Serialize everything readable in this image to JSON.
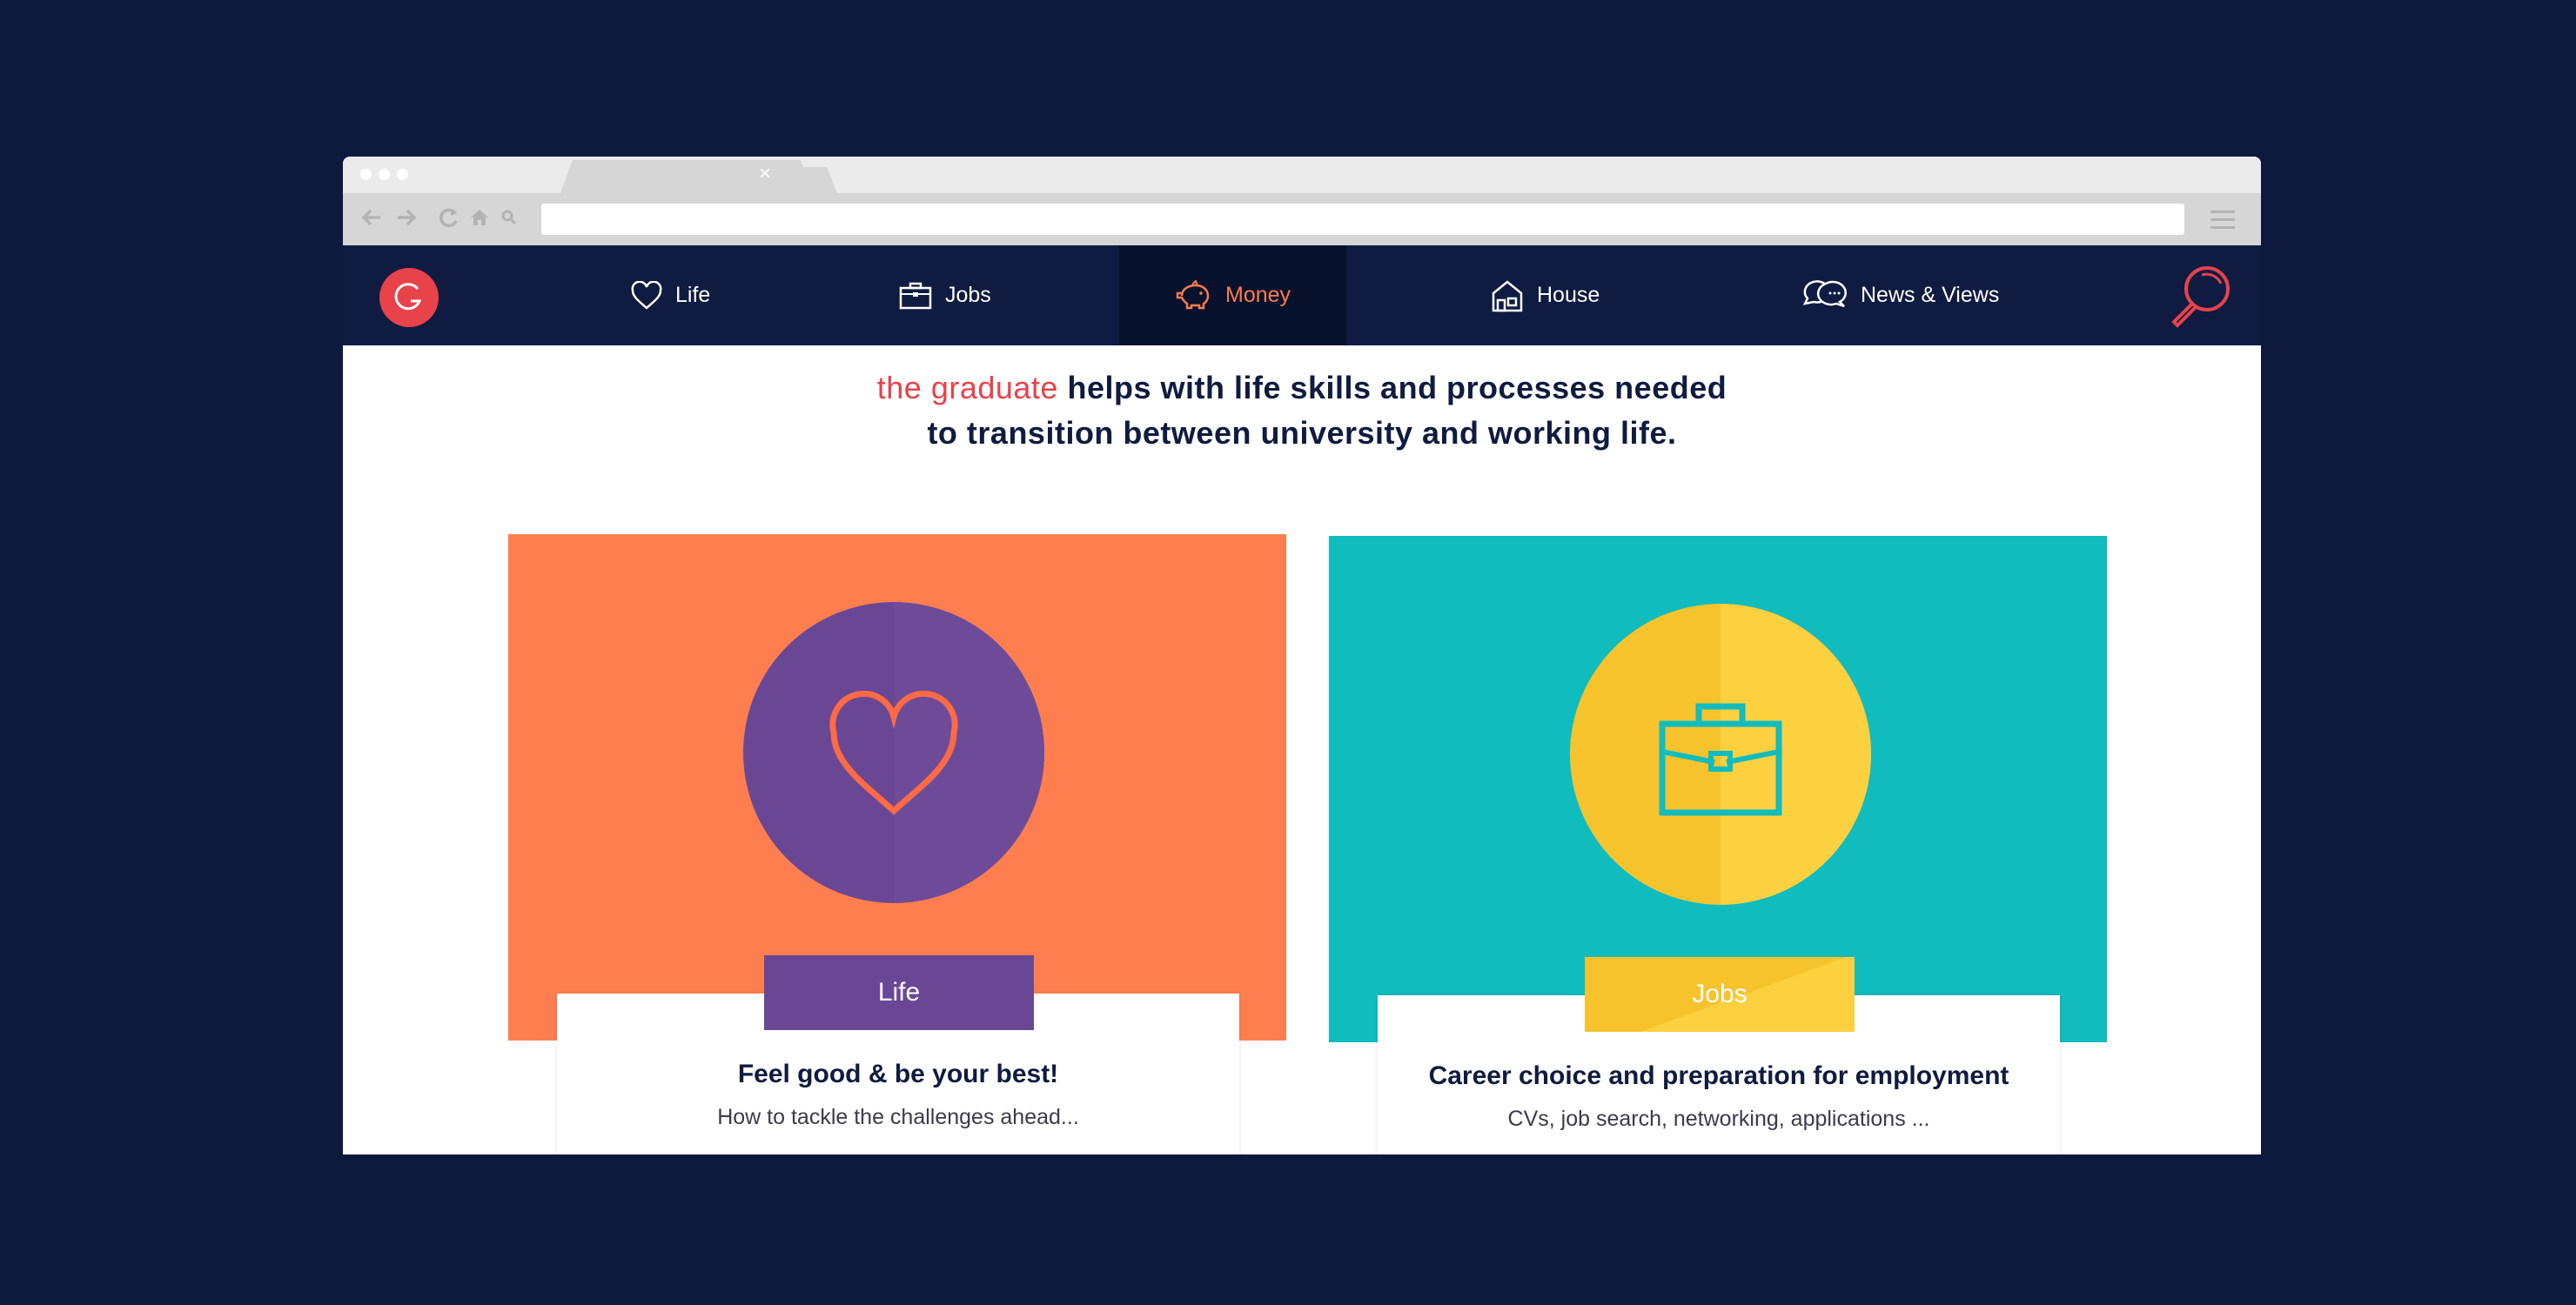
{
  "browser": {
    "tab_close_glyph": "×",
    "icons": [
      "back-arrow-icon",
      "forward-arrow-icon",
      "reload-icon",
      "home-icon",
      "search-icon",
      "hamburger-menu-icon"
    ]
  },
  "nav": {
    "items": [
      {
        "label": "Life",
        "icon": "heart-icon"
      },
      {
        "label": "Jobs",
        "icon": "briefcase-icon"
      },
      {
        "label": "Money",
        "icon": "piggy-bank-icon",
        "active": true
      },
      {
        "label": "House",
        "icon": "house-icon"
      },
      {
        "label": "News & Views",
        "icon": "chat-bubbles-icon"
      }
    ]
  },
  "intro": {
    "brand": "the graduate",
    "line1_rest": " helps with life skills and processes needed",
    "line2": "to transition between university and working life."
  },
  "cards": [
    {
      "label": "Life",
      "title": "Feel good & be your best!",
      "subtitle": "How to tackle the challenges ahead...",
      "icon": "heart-icon"
    },
    {
      "label": "Jobs",
      "title": "Career choice and preparation for employment",
      "subtitle": "CVs, job search, networking, applications ...",
      "icon": "briefcase-icon"
    }
  ],
  "colors": {
    "page_bg": "#0d1a3e",
    "header_bg": "#0f1b40",
    "accent_red": "#e8424b",
    "accent_orange": "#ff7a4f",
    "life_orange": "#ff7e50",
    "life_purple": "#6a4795",
    "jobs_teal": "#10bcbe",
    "jobs_yellow": "#f6c32d"
  }
}
